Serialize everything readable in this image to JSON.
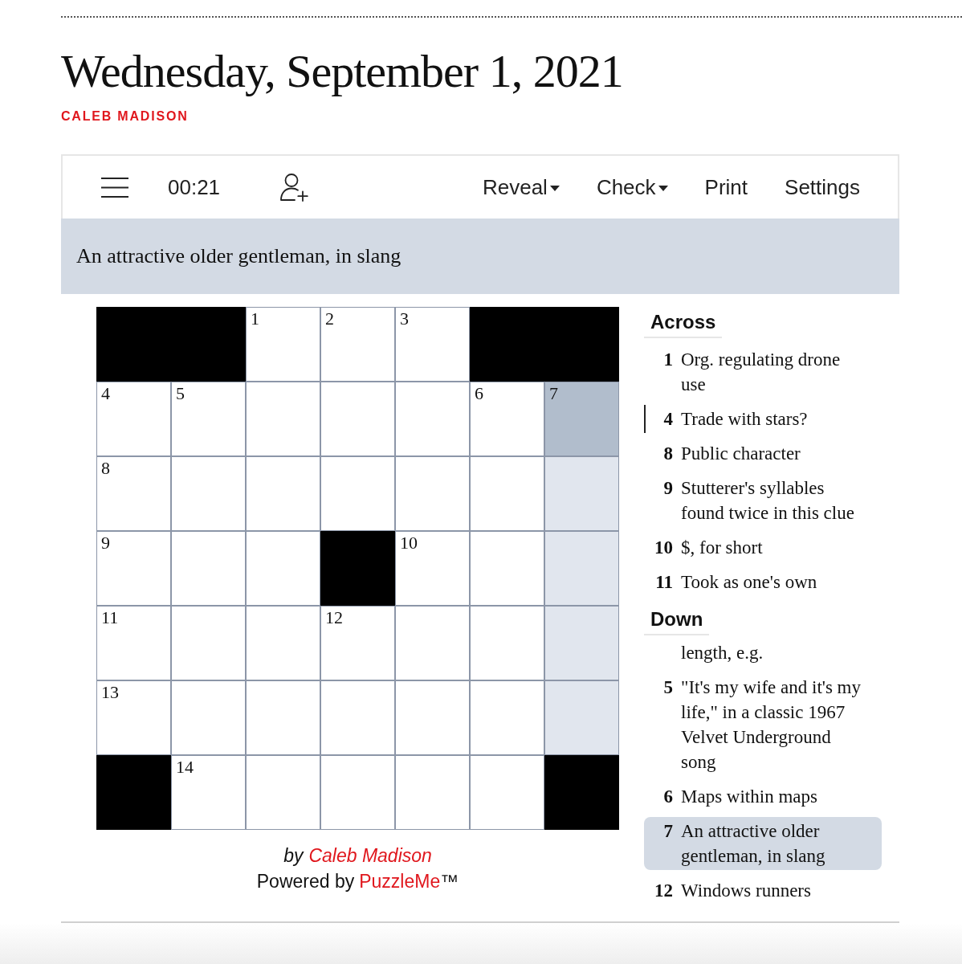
{
  "header": {
    "date": "Wednesday, September 1, 2021",
    "author": "CALEB MADISON"
  },
  "toolbar": {
    "timer": "00:21",
    "buttons": [
      {
        "label": "Reveal",
        "dropdown": true
      },
      {
        "label": "Check",
        "dropdown": true
      },
      {
        "label": "Print",
        "dropdown": false
      },
      {
        "label": "Settings",
        "dropdown": false
      }
    ]
  },
  "clue_bar": {
    "text": "An attractive older gentleman, in slang"
  },
  "grid": {
    "rows": [
      [
        {
          "kind": "block",
          "selected": false,
          "highlighted": false
        },
        {
          "kind": "block",
          "selected": false,
          "highlighted": false
        },
        {
          "kind": "letter",
          "number": "1",
          "selected": false,
          "highlighted": false
        },
        {
          "kind": "letter",
          "number": "2",
          "selected": false,
          "highlighted": false
        },
        {
          "kind": "letter",
          "number": "3",
          "selected": false,
          "highlighted": false
        },
        {
          "kind": "block",
          "selected": false,
          "highlighted": false
        },
        {
          "kind": "block",
          "selected": false,
          "highlighted": false
        }
      ],
      [
        {
          "kind": "letter",
          "number": "4",
          "selected": false,
          "highlighted": false
        },
        {
          "kind": "letter",
          "number": "5",
          "selected": false,
          "highlighted": false
        },
        {
          "kind": "letter",
          "selected": false,
          "highlighted": false
        },
        {
          "kind": "letter",
          "selected": false,
          "highlighted": false
        },
        {
          "kind": "letter",
          "selected": false,
          "highlighted": false
        },
        {
          "kind": "letter",
          "number": "6",
          "selected": false,
          "highlighted": false
        },
        {
          "kind": "letter",
          "number": "7",
          "selected": true,
          "highlighted": false
        }
      ],
      [
        {
          "kind": "letter",
          "number": "8",
          "selected": false,
          "highlighted": false
        },
        {
          "kind": "letter",
          "selected": false,
          "highlighted": false
        },
        {
          "kind": "letter",
          "selected": false,
          "highlighted": false
        },
        {
          "kind": "letter",
          "selected": false,
          "highlighted": false
        },
        {
          "kind": "letter",
          "selected": false,
          "highlighted": false
        },
        {
          "kind": "letter",
          "selected": false,
          "highlighted": false
        },
        {
          "kind": "letter",
          "selected": false,
          "highlighted": true
        }
      ],
      [
        {
          "kind": "letter",
          "number": "9",
          "selected": false,
          "highlighted": false
        },
        {
          "kind": "letter",
          "selected": false,
          "highlighted": false
        },
        {
          "kind": "letter",
          "selected": false,
          "highlighted": false
        },
        {
          "kind": "block",
          "selected": false,
          "highlighted": false
        },
        {
          "kind": "letter",
          "number": "10",
          "selected": false,
          "highlighted": false
        },
        {
          "kind": "letter",
          "selected": false,
          "highlighted": false
        },
        {
          "kind": "letter",
          "selected": false,
          "highlighted": true
        }
      ],
      [
        {
          "kind": "letter",
          "number": "11",
          "selected": false,
          "highlighted": false
        },
        {
          "kind": "letter",
          "selected": false,
          "highlighted": false
        },
        {
          "kind": "letter",
          "selected": false,
          "highlighted": false
        },
        {
          "kind": "letter",
          "number": "12",
          "selected": false,
          "highlighted": false
        },
        {
          "kind": "letter",
          "selected": false,
          "highlighted": false
        },
        {
          "kind": "letter",
          "selected": false,
          "highlighted": false
        },
        {
          "kind": "letter",
          "selected": false,
          "highlighted": true
        }
      ],
      [
        {
          "kind": "letter",
          "number": "13",
          "selected": false,
          "highlighted": false
        },
        {
          "kind": "letter",
          "selected": false,
          "highlighted": false
        },
        {
          "kind": "letter",
          "selected": false,
          "highlighted": false
        },
        {
          "kind": "letter",
          "selected": false,
          "highlighted": false
        },
        {
          "kind": "letter",
          "selected": false,
          "highlighted": false
        },
        {
          "kind": "letter",
          "selected": false,
          "highlighted": false
        },
        {
          "kind": "letter",
          "selected": false,
          "highlighted": true
        }
      ],
      [
        {
          "kind": "block",
          "selected": false,
          "highlighted": false
        },
        {
          "kind": "letter",
          "number": "14",
          "selected": false,
          "highlighted": false
        },
        {
          "kind": "letter",
          "selected": false,
          "highlighted": false
        },
        {
          "kind": "letter",
          "selected": false,
          "highlighted": false
        },
        {
          "kind": "letter",
          "selected": false,
          "highlighted": false
        },
        {
          "kind": "letter",
          "selected": false,
          "highlighted": false
        },
        {
          "kind": "block",
          "selected": false,
          "highlighted": false
        }
      ]
    ]
  },
  "clue_lists": [
    {
      "heading": "Across",
      "items": [
        {
          "number": "1",
          "text": "Org. regulating drone use",
          "selected": false,
          "crossing": false
        },
        {
          "number": "4",
          "text": "Trade with stars?",
          "selected": false,
          "crossing": true
        },
        {
          "number": "8",
          "text": "Public character",
          "selected": false,
          "crossing": false
        },
        {
          "number": "9",
          "text": "Stutterer's syllables found twice in this clue",
          "selected": false,
          "crossing": false
        },
        {
          "number": "10",
          "text": "$, for short",
          "selected": false,
          "crossing": false
        },
        {
          "number": "11",
          "text": "Took as one's own",
          "selected": false,
          "crossing": false
        }
      ]
    },
    {
      "heading": "Down",
      "items": [
        {
          "text": "length, e.g.",
          "selected": false,
          "crossing": false
        },
        {
          "number": "5",
          "text": "\"It's my wife and it's my life,\" in a classic 1967 Velvet Underground song",
          "selected": false,
          "crossing": false
        },
        {
          "number": "6",
          "text": "Maps within maps",
          "selected": false,
          "crossing": false
        },
        {
          "number": "7",
          "text": "An attractive older gentleman, in slang",
          "selected": true,
          "crossing": false
        },
        {
          "number": "12",
          "text": "Windows runners",
          "selected": false,
          "crossing": false
        }
      ]
    }
  ],
  "byline": {
    "prefix": "by",
    "author": "Caleb Madison"
  },
  "powered_by": {
    "prefix": "Powered by",
    "brand": "PuzzleMe",
    "mark": "™"
  }
}
